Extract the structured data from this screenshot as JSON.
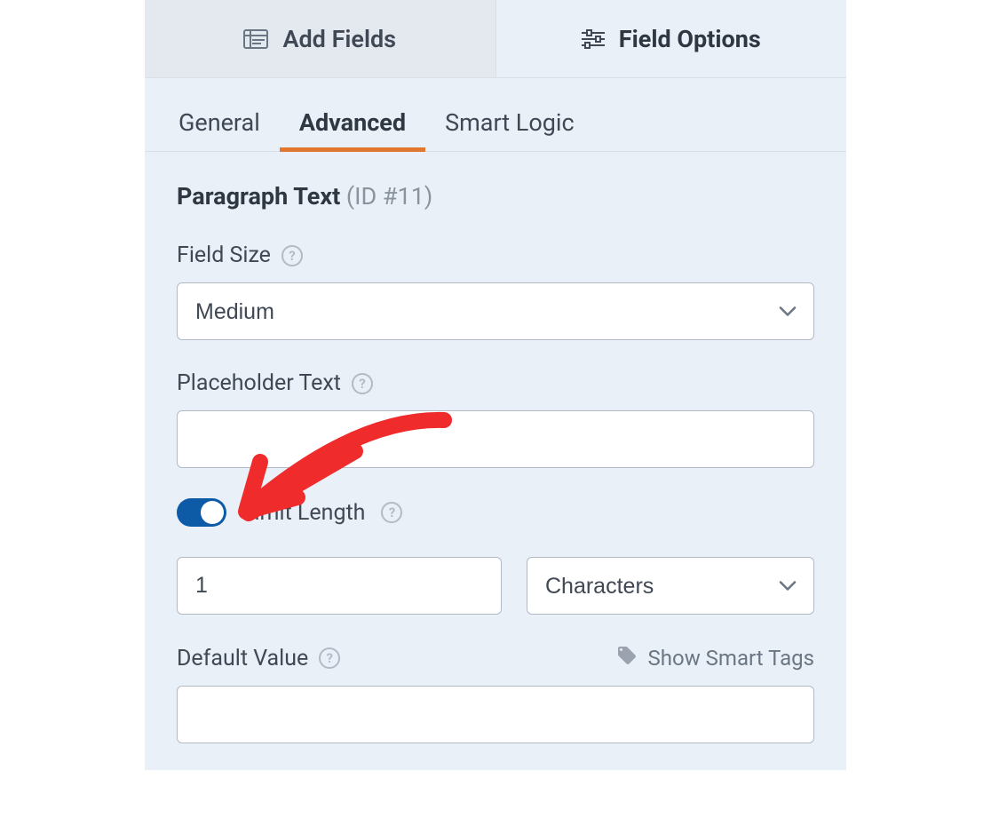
{
  "topTabs": {
    "addFields": "Add Fields",
    "fieldOptions": "Field Options"
  },
  "subTabs": {
    "general": "General",
    "advanced": "Advanced",
    "smartLogic": "Smart Logic"
  },
  "fieldTitle": {
    "name": "Paragraph Text",
    "id": "(ID #11)"
  },
  "labels": {
    "fieldSize": "Field Size",
    "placeholderText": "Placeholder Text",
    "limitLength": "Limit Length",
    "defaultValue": "Default Value",
    "showSmartTags": "Show Smart Tags"
  },
  "values": {
    "fieldSize": "Medium",
    "placeholderText": "",
    "limitLengthEnabled": true,
    "limitNumber": "1",
    "limitUnit": "Characters",
    "defaultValue": ""
  }
}
